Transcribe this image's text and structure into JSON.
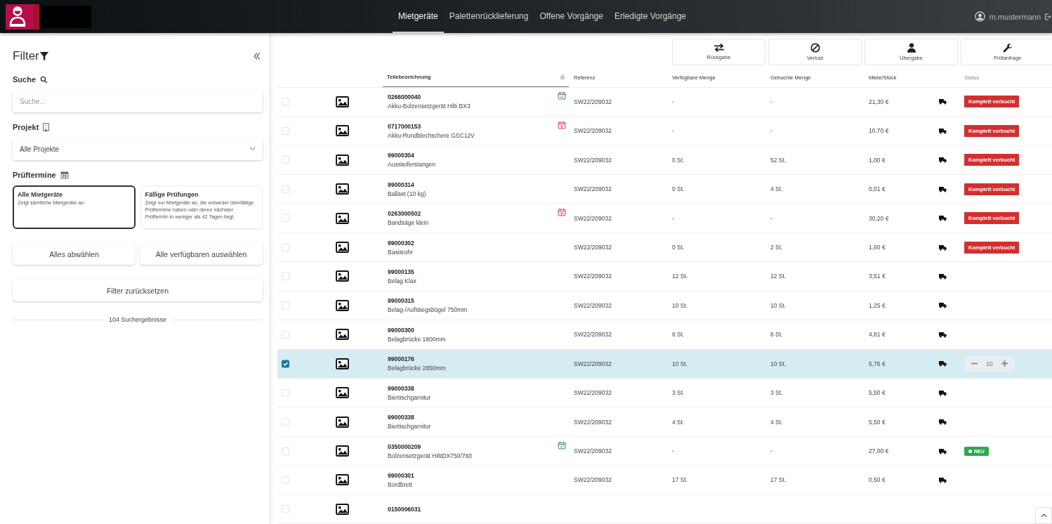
{
  "topbar": {
    "nav": [
      {
        "label": "Mietgeräte",
        "selected": true
      },
      {
        "label": "Palettenrücklieferung",
        "selected": false
      },
      {
        "label": "Offene Vorgänge",
        "selected": false
      },
      {
        "label": "Erledigte Vorgänge",
        "selected": false
      }
    ],
    "user": "m.mustermann"
  },
  "filter": {
    "title": "Filter",
    "search_label": "Suche",
    "search": {
      "placeholder": "Suche..."
    },
    "project_label": "Projekt",
    "project": {
      "value": "Alle Projekte"
    },
    "inspection_label": "Prüftermine",
    "options": [
      {
        "title": "Alle Mietgeräte",
        "description": "Zeigt sämtliche Mietgeräte an.",
        "selected": true
      },
      {
        "title": "Fällige Prüfungen",
        "description": "Zeigt nur Mietgeräte an, die entweder überfällige Prüftermine haben oder deren nächster Prüftermin in weniger als 42 Tagen liegt.",
        "selected": false
      }
    ],
    "buttons": [
      "Alles abwählen",
      "Alle verfügbaren auswählen"
    ],
    "reset": "Filter zurücksetzen",
    "results": "104 Suchergebnisse"
  },
  "actions": [
    {
      "label": "Rückgabe",
      "kind": "swap"
    },
    {
      "label": "Verlust",
      "kind": "ban"
    },
    {
      "label": "Übergabe",
      "kind": "user"
    },
    {
      "label": "Prüfanfrage",
      "kind": "wrench"
    }
  ],
  "table": {
    "columns": [
      "Teilebezeichnung",
      "Referenz",
      "Verfügbare Menge",
      "Gebuchte Menge",
      "Miete/Stück",
      "Status"
    ],
    "rows": [
      {
        "selected": false,
        "code": "0266000040",
        "name": "Akku-Bolzensetzgerät Hilti BX3",
        "calendar": {
          "kind": "ok"
        },
        "reference": "SW22/209032",
        "available": "-",
        "booked": "-",
        "price": "21,30 €",
        "status": {
          "kind": "booked",
          "label": "Komplett verbucht"
        }
      },
      {
        "selected": false,
        "code": "0717000153",
        "name": "Akku-Rundblechschere GSC12V",
        "calendar": {
          "kind": "overdue"
        },
        "reference": "SW22/209032",
        "available": "-",
        "booked": "-",
        "price": "10,70 €",
        "status": {
          "kind": "booked",
          "label": "Komplett verbucht"
        }
      },
      {
        "selected": false,
        "code": "99000304",
        "name": "Aussteiferstangen",
        "reference": "SW22/209032",
        "available": "0 St.",
        "booked": "52 St.",
        "price": "1,00 €",
        "status": {
          "kind": "booked",
          "label": "Komplett verbucht"
        }
      },
      {
        "selected": false,
        "code": "99000314",
        "name": "Ballast (10 kg)",
        "reference": "SW22/209032",
        "available": "0 St.",
        "booked": "4 St.",
        "price": "0,01 €",
        "status": {
          "kind": "booked",
          "label": "Komplett verbucht"
        }
      },
      {
        "selected": false,
        "code": "0263000502",
        "name": "Bandsäge klein",
        "calendar": {
          "kind": "overdue"
        },
        "reference": "SW22/209032",
        "available": "-",
        "booked": "-",
        "price": "30,20 €",
        "status": {
          "kind": "booked",
          "label": "Komplett verbucht"
        }
      },
      {
        "selected": false,
        "code": "99000302",
        "name": "Basisrohr",
        "reference": "SW22/209032",
        "available": "0 St.",
        "booked": "2 St.",
        "price": "1,60 €",
        "status": {
          "kind": "booked",
          "label": "Komplett verbucht"
        }
      },
      {
        "selected": false,
        "code": "99000135",
        "name": "Belag Klax",
        "reference": "SW22/209032",
        "available": "12 St.",
        "booked": "12 St.",
        "price": "3,51 €"
      },
      {
        "selected": false,
        "code": "99000315",
        "name": "Belag-/Aufstiegsbügel 750mm",
        "reference": "SW22/209032",
        "available": "10 St.",
        "booked": "10 St.",
        "price": "1,25 €"
      },
      {
        "selected": false,
        "code": "99000300",
        "name": "Belagbrücke 1800mm",
        "reference": "SW22/209032",
        "available": "6 St.",
        "booked": "6 St.",
        "price": "4,81 €"
      },
      {
        "selected": true,
        "code": "99000176",
        "name": "Belagbrücke 2850mm",
        "reference": "SW22/209032",
        "available": "10 St.",
        "booked": "10 St.",
        "price": "5,76 €",
        "status": {
          "kind": "quantity",
          "value": "10"
        }
      },
      {
        "selected": false,
        "code": "99000338",
        "name": "Biertischgarnitur",
        "reference": "SW22/209032",
        "available": "3 St.",
        "booked": "3 St.",
        "price": "5,50 €"
      },
      {
        "selected": false,
        "code": "99000338",
        "name": "Biertischgarnitur",
        "reference": "SW22/209032",
        "available": "4 St.",
        "booked": "4 St.",
        "price": "5,50 €"
      },
      {
        "selected": false,
        "code": "0350000209",
        "name": "Bolzensetzgerät HiltiDX750/760",
        "calendar": {
          "kind": "ok"
        },
        "reference": "SW22/209032",
        "available": "-",
        "booked": "-",
        "price": "27,00 €",
        "status": {
          "kind": "new",
          "label": "NEU"
        }
      },
      {
        "selected": false,
        "code": "99000301",
        "name": "Bordbrett",
        "reference": "SW22/209032",
        "available": "17 St.",
        "booked": "17 St.",
        "price": "0,50 €"
      },
      {
        "selected": false,
        "code": "0150006031"
      }
    ]
  }
}
